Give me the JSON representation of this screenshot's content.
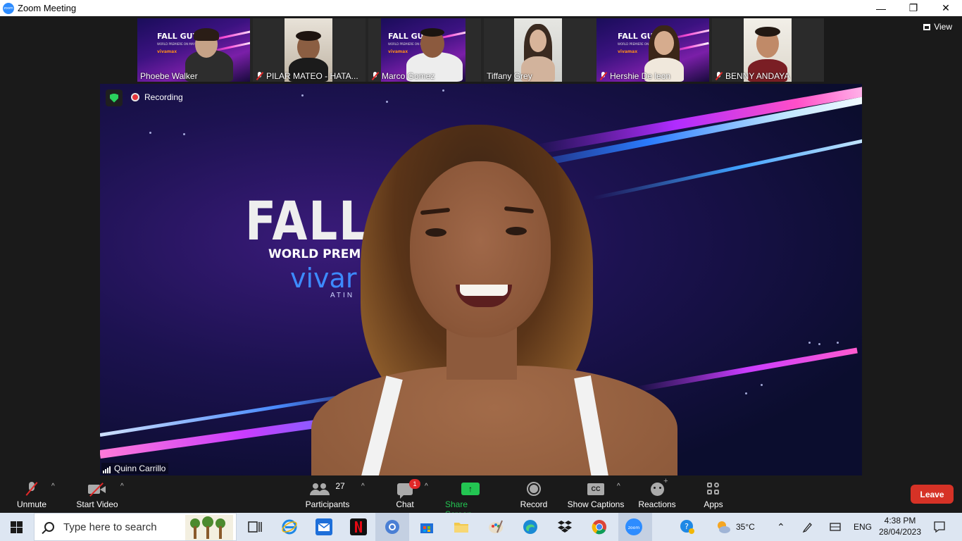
{
  "window": {
    "title": "Zoom Meeting",
    "minimize": "—",
    "restore": "❐",
    "close": "✕"
  },
  "view_button": "View",
  "participants_strip": [
    {
      "name": "Phoebe Walker",
      "muted": false
    },
    {
      "name": "PILAR MATEO - HATA...",
      "muted": true
    },
    {
      "name": "Marco Gomez",
      "muted": true
    },
    {
      "name": "Tiffany Grey",
      "muted": false
    },
    {
      "name": "Hershie De leon",
      "muted": true
    },
    {
      "name": "BENNY ANDAYA",
      "muted": true
    }
  ],
  "thumbnail_logo": {
    "title": "FALL GUY",
    "tagline": "WORLD PREMIERE ON MAY 5",
    "brand": "vivamax"
  },
  "main_video": {
    "speaker": "Quinn Carrillo",
    "recording_label": "Recording",
    "backdrop_title": "FALL G",
    "backdrop_sub": "WORLD PREMIERE",
    "backdrop_brand": "vivar",
    "backdrop_tag": "ATIN"
  },
  "toolbar": {
    "unmute": "Unmute",
    "start_video": "Start Video",
    "participants": "Participants",
    "participants_count": "27",
    "chat": "Chat",
    "chat_badge": "1",
    "share_screen": "Share Screen",
    "record": "Record",
    "show_captions": "Show Captions",
    "cc": "CC",
    "reactions": "Reactions",
    "apps": "Apps",
    "leave": "Leave",
    "caret": "^"
  },
  "taskbar": {
    "search_placeholder": "Type here to search",
    "temperature": "35°C",
    "language": "ENG",
    "time": "4:38 PM",
    "date": "28/04/2023"
  },
  "colors": {
    "leave": "#d63226",
    "share": "#23c552",
    "mute_slash": "#e02828",
    "secure": "#2ad15e"
  }
}
